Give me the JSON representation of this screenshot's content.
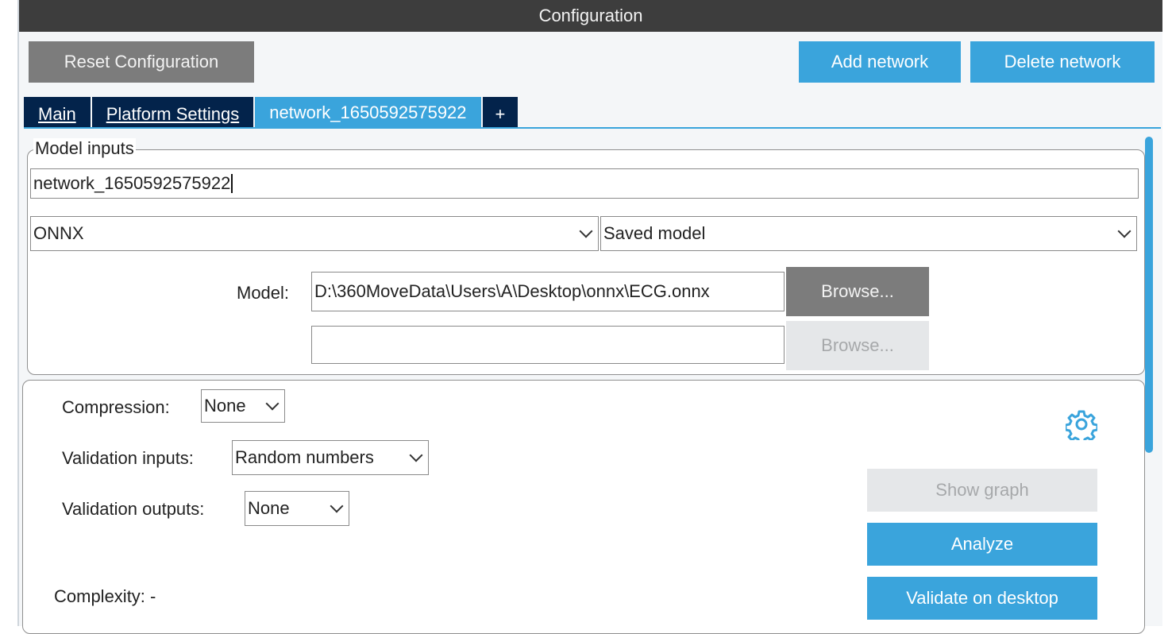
{
  "window": {
    "title": "Configuration"
  },
  "toolbar": {
    "reset_label": "Reset Configuration",
    "add_network_label": "Add network",
    "delete_network_label": "Delete network"
  },
  "tabs": [
    {
      "label": "Main",
      "active": false
    },
    {
      "label": "Platform Settings",
      "active": false
    },
    {
      "label": "network_1650592575922",
      "active": true
    },
    {
      "label": "+",
      "active": false
    }
  ],
  "model_inputs": {
    "legend": "Model inputs",
    "network_name": "network_1650592575922",
    "framework": "ONNX",
    "model_type": "Saved model",
    "model_label": "Model:",
    "model_path": "D:\\360MoveData\\Users\\A\\Desktop\\onnx\\ECG.onnx",
    "browse_label": "Browse...",
    "second_path": "",
    "browse2_label": "Browse..."
  },
  "settings": {
    "compression_label": "Compression:",
    "compression_value": "None",
    "validation_inputs_label": "Validation inputs:",
    "validation_inputs_value": "Random numbers",
    "validation_outputs_label": "Validation outputs:",
    "validation_outputs_value": "None",
    "complexity_label": "Complexity: -",
    "show_graph_label": "Show graph",
    "analyze_label": "Analyze",
    "validate_label": "Validate on desktop",
    "settings_icon": "gear-icon"
  },
  "colors": {
    "accent": "#3aa4dc",
    "tab_dark": "#03234b",
    "title_bar": "#3d3d3d",
    "gray_button": "#7c7c7c"
  }
}
